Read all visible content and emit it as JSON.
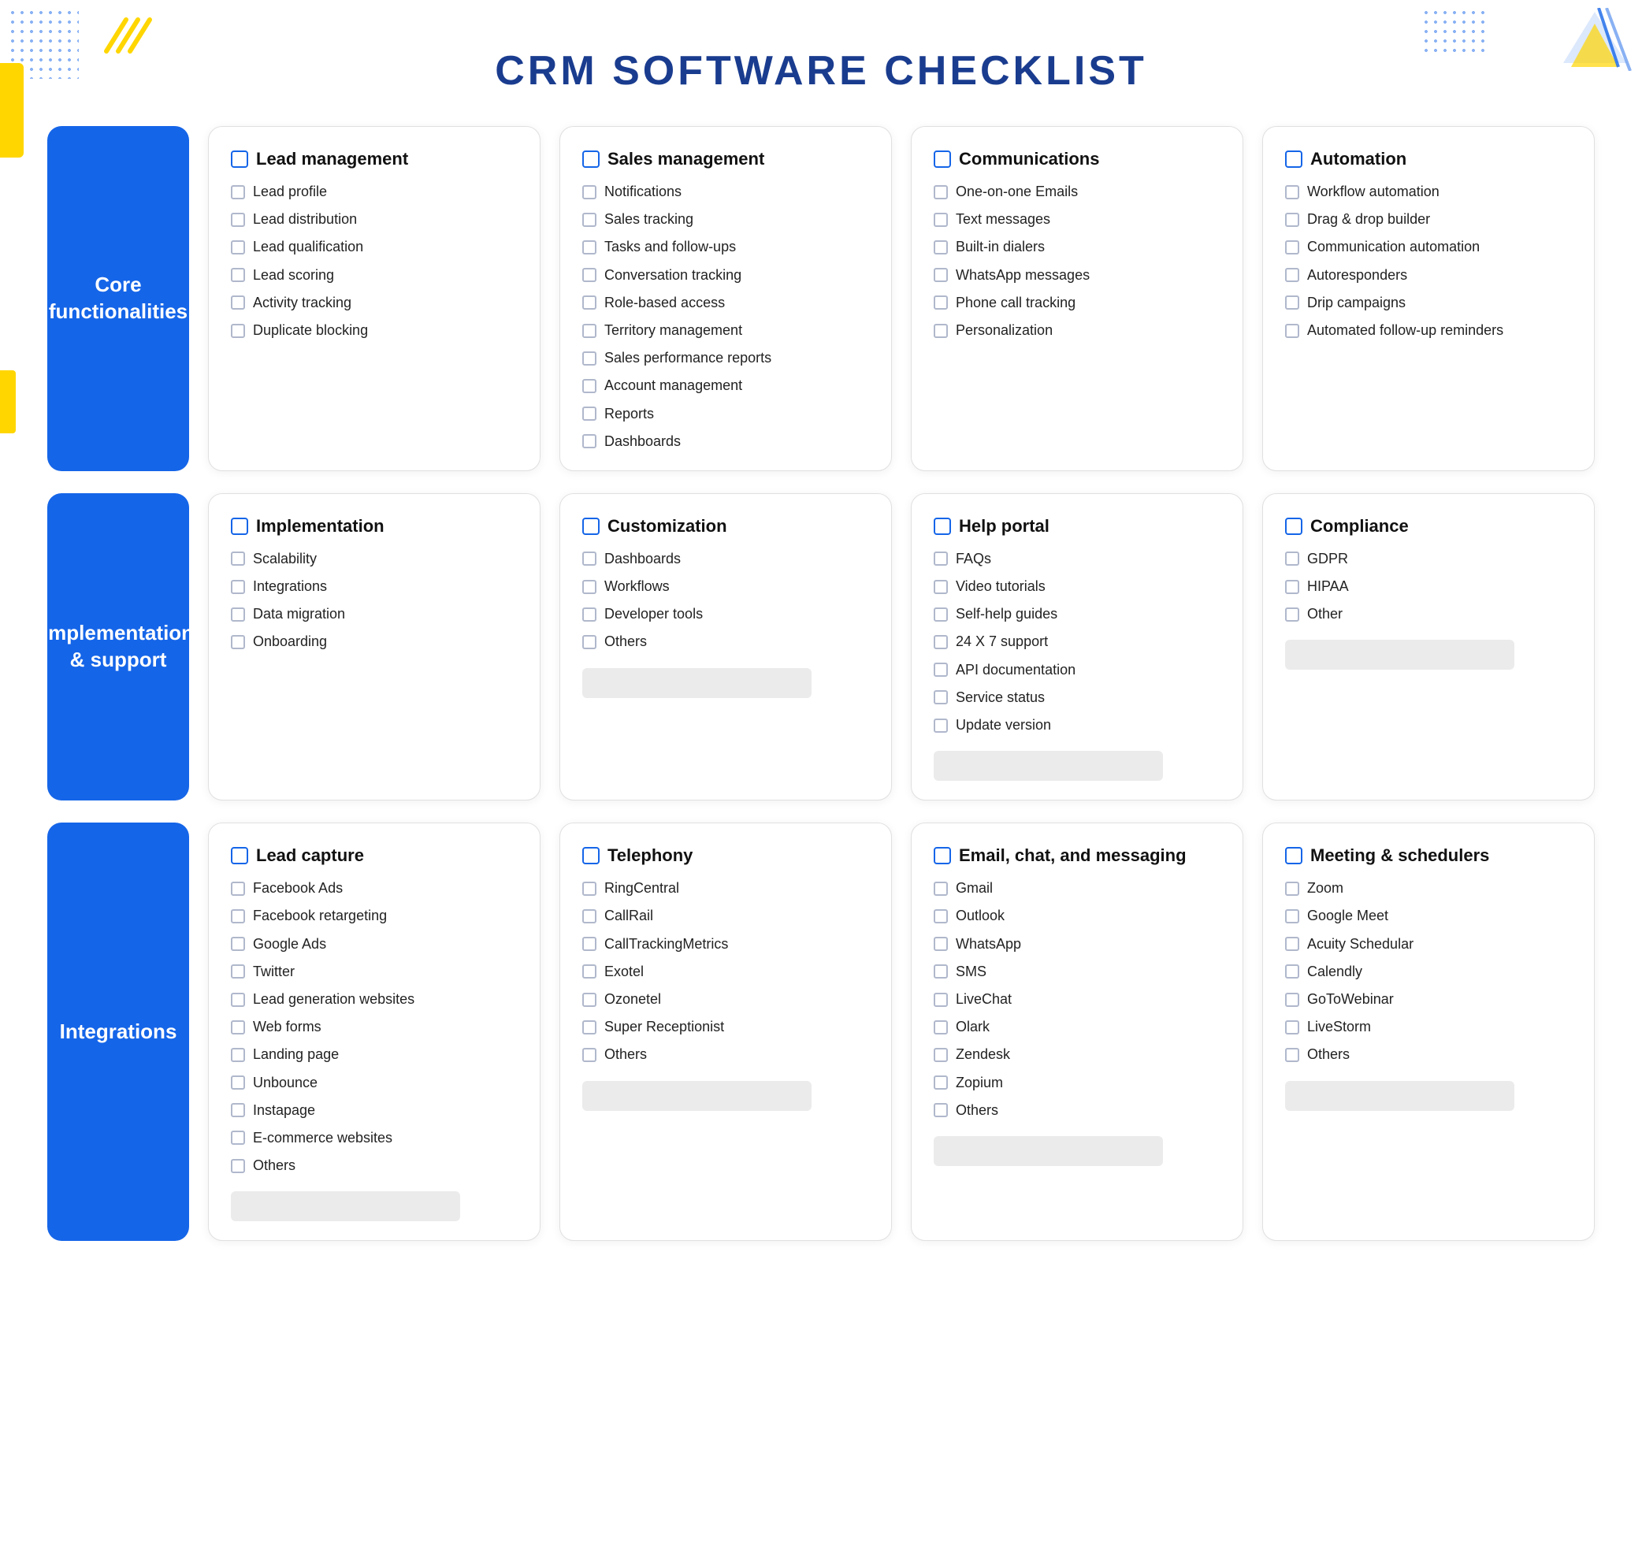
{
  "page": {
    "title": "CRM SOFTWARE CHECKLIST"
  },
  "rows": [
    {
      "id": "core",
      "label": "Core\nfunctionalities",
      "cards": [
        {
          "id": "lead-management",
          "title": "Lead management",
          "items": [
            "Lead profile",
            "Lead distribution",
            "Lead qualification",
            "Lead scoring",
            "Activity tracking",
            "Duplicate blocking"
          ]
        },
        {
          "id": "sales-management",
          "title": "Sales management",
          "items": [
            "Notifications",
            "Sales tracking",
            "Tasks and follow-ups",
            "Conversation tracking",
            "Role-based access",
            "Territory management",
            "Sales performance reports",
            "Account management",
            "Reports",
            "Dashboards"
          ]
        },
        {
          "id": "communications",
          "title": "Communications",
          "items": [
            "One-on-one Emails",
            "Text messages",
            "Built-in dialers",
            "WhatsApp messages",
            "Phone call tracking",
            "Personalization"
          ]
        },
        {
          "id": "automation",
          "title": "Automation",
          "items": [
            "Workflow automation",
            "Drag & drop builder",
            "Communication automation",
            "Autoresponders",
            "Drip campaigns",
            "Automated follow-up reminders"
          ]
        }
      ]
    },
    {
      "id": "implementation",
      "label": "Implementation\n& support",
      "cards": [
        {
          "id": "implementation",
          "title": "Implementation",
          "items": [
            "Scalability",
            "Integrations",
            "Data migration",
            "Onboarding"
          ],
          "hasInput": false
        },
        {
          "id": "customization",
          "title": "Customization",
          "items": [
            "Dashboards",
            "Workflows",
            "Developer tools",
            "Others"
          ],
          "hasInput": true
        },
        {
          "id": "help-portal",
          "title": "Help portal",
          "items": [
            "FAQs",
            "Video tutorials",
            "Self-help guides",
            "24 X 7 support",
            "API documentation",
            "Service status",
            "Update version"
          ],
          "hasInput": true
        },
        {
          "id": "compliance",
          "title": "Compliance",
          "items": [
            "GDPR",
            "HIPAA",
            "Other"
          ],
          "hasInput": true
        }
      ]
    },
    {
      "id": "integrations",
      "label": "Integrations",
      "cards": [
        {
          "id": "lead-capture",
          "title": "Lead capture",
          "items": [
            "Facebook Ads",
            "Facebook retargeting",
            "Google Ads",
            "Twitter",
            "Lead generation websites",
            "Web forms",
            "Landing page",
            "Unbounce",
            "Instapage",
            "E-commerce websites",
            "Others"
          ],
          "hasInput": true
        },
        {
          "id": "telephony",
          "title": "Telephony",
          "items": [
            "RingCentral",
            "CallRail",
            "CallTrackingMetrics",
            "Exotel",
            "Ozonetel",
            "Super Receptionist",
            "Others"
          ],
          "hasInput": true
        },
        {
          "id": "email-chat-messaging",
          "title": "Email, chat, and messaging",
          "items": [
            "Gmail",
            "Outlook",
            "WhatsApp",
            "SMS",
            "LiveChat",
            "Olark",
            "Zendesk",
            "Zopium",
            "Others"
          ],
          "hasInput": true
        },
        {
          "id": "meeting-schedulers",
          "title": "Meeting & schedulers",
          "items": [
            "Zoom",
            "Google Meet",
            "Acuity Schedular",
            "Calendly",
            "GoToWebinar",
            "LiveStorm",
            "Others"
          ],
          "hasInput": true
        }
      ]
    }
  ]
}
